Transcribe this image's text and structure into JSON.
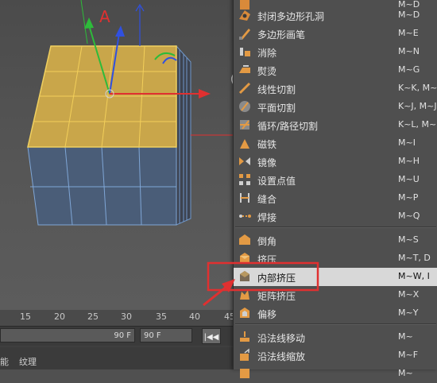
{
  "timeline": {
    "ruler_ticks": [
      "15",
      "20",
      "25",
      "30",
      "35",
      "40",
      "45"
    ],
    "frame_end_field": "90 F",
    "frame_max_field": "90 F",
    "go_to_start_glyph": "|◀◀",
    "bottom_tabs": [
      "能",
      "纹理"
    ]
  },
  "viewport": {
    "axis_label": "A"
  },
  "menu": {
    "items": [
      {
        "label": "",
        "shortcut": "M~D",
        "icon": "polygon-tool-icon"
      },
      {
        "label": "封闭多边形孔洞",
        "shortcut": "M~D",
        "icon": "close-hole-icon"
      },
      {
        "label": "多边形画笔",
        "shortcut": "M~E",
        "icon": "polygon-pen-icon"
      },
      {
        "label": "消除",
        "shortcut": "M~N",
        "icon": "dissolve-icon"
      },
      {
        "label": "熨烫",
        "shortcut": "M~G",
        "icon": "iron-icon"
      },
      {
        "label": "线性切割",
        "shortcut": "K~K, M~K",
        "icon": "knife-line-icon"
      },
      {
        "label": "平面切割",
        "shortcut": "K~J, M~J",
        "icon": "plane-cut-icon"
      },
      {
        "label": "循环/路径切割",
        "shortcut": "K~L, M~L",
        "icon": "loop-cut-icon"
      },
      {
        "label": "磁铁",
        "shortcut": "M~I",
        "icon": "magnet-icon"
      },
      {
        "label": "镜像",
        "shortcut": "M~H",
        "icon": "mirror-icon"
      },
      {
        "label": "设置点值",
        "shortcut": "M~U",
        "icon": "set-point-icon"
      },
      {
        "label": "缝合",
        "shortcut": "M~P",
        "icon": "stitch-icon"
      },
      {
        "label": "焊接",
        "shortcut": "M~Q",
        "icon": "weld-icon"
      },
      {
        "label": "倒角",
        "shortcut": "M~S",
        "icon": "bevel-icon"
      },
      {
        "label": "挤压",
        "shortcut": "M~T, D",
        "icon": "extrude-icon"
      },
      {
        "label": "内部挤压",
        "shortcut": "M~W, I",
        "icon": "extrude-inner-icon",
        "highlighted": true
      },
      {
        "label": "矩阵挤压",
        "shortcut": "M~X",
        "icon": "matrix-extrude-icon"
      },
      {
        "label": "偏移",
        "shortcut": "M~Y",
        "icon": "offset-icon"
      },
      {
        "label": "沿法线移动",
        "shortcut": "M~",
        "icon": "normal-move-icon"
      },
      {
        "label": "沿法线缩放",
        "shortcut": "M~F",
        "icon": "normal-scale-icon"
      },
      {
        "label": "",
        "shortcut": "M~",
        "icon": "normal-rotate-icon"
      }
    ]
  },
  "colors": {
    "highlight": "#d8d8d8",
    "callout": "#e03030",
    "face_selected": "#c9a64a",
    "axis_x": "#e03030",
    "axis_y": "#2dbb3a",
    "axis_z": "#3050e0"
  }
}
